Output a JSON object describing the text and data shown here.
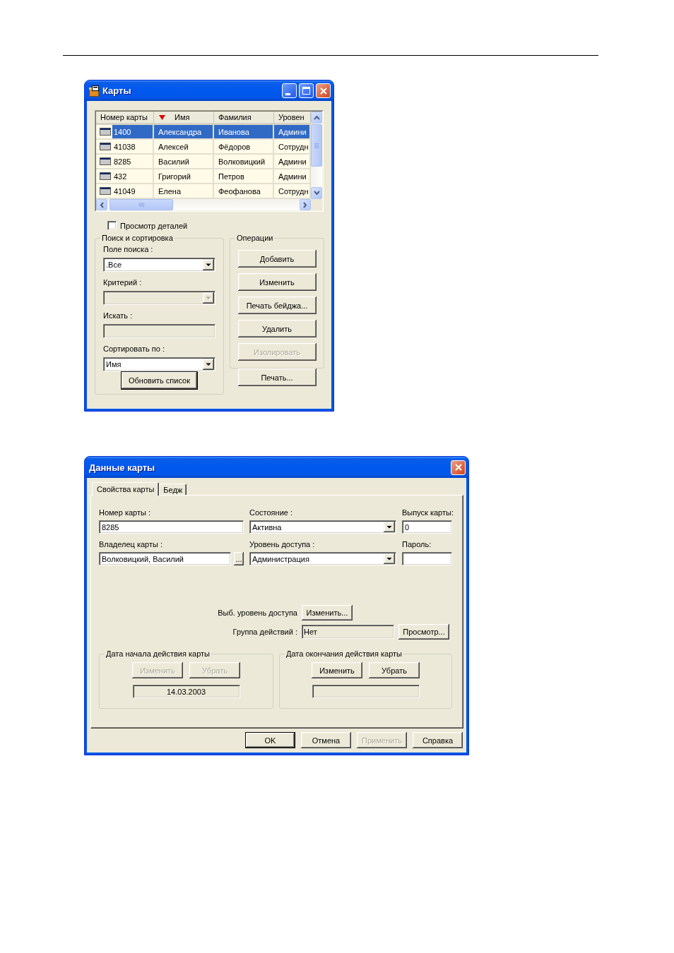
{
  "cards_window": {
    "title": "Карты",
    "table": {
      "columns": [
        {
          "label": "Номер карты",
          "sorted": false
        },
        {
          "label": "Имя",
          "sorted": true
        },
        {
          "label": "Фамилия",
          "sorted": false
        },
        {
          "label": "Уровен",
          "sorted": false
        }
      ],
      "rows": [
        {
          "selected": true,
          "cells": [
            "1400",
            "Александра",
            "Иванова",
            "Админи"
          ]
        },
        {
          "selected": false,
          "cells": [
            "41038",
            "Алексей",
            "Фёдоров",
            "Сотрудн"
          ]
        },
        {
          "selected": false,
          "cells": [
            "8285",
            "Василий",
            "Волковицкий",
            "Админи"
          ]
        },
        {
          "selected": false,
          "cells": [
            "432",
            "Григорий",
            "Петров",
            "Админи"
          ]
        },
        {
          "selected": false,
          "cells": [
            "41049",
            "Елена",
            "Феофанова",
            "Сотрудн"
          ]
        }
      ]
    },
    "details_checkbox": {
      "label": "Просмотр деталей",
      "checked": false
    },
    "search_group": {
      "title": "Поиск и сортировка",
      "fields": [
        {
          "kind": "combo",
          "label": "Поле поиска :",
          "value": ".Все",
          "disabled": false
        },
        {
          "kind": "combo",
          "label": "Критерий :",
          "disabled": true
        },
        {
          "kind": "text",
          "label": "Искать :",
          "disabled": true
        },
        {
          "kind": "combo",
          "label": "Сортировать по :",
          "value": "Имя",
          "disabled": false
        }
      ],
      "button": {
        "label": "Обновить список",
        "default": true
      }
    },
    "operations_group": {
      "title": "Операции",
      "buttons": [
        {
          "label": "Добавить",
          "disabled": false
        },
        {
          "label": "Изменить",
          "disabled": false
        },
        {
          "label": "Печать бейджа...",
          "disabled": false
        },
        {
          "label": "Удалить",
          "disabled": false
        },
        {
          "label": "Изолировать",
          "disabled": true
        }
      ]
    },
    "print_button": {
      "label": "Печать..."
    }
  },
  "card_dialog": {
    "title": "Данные карты",
    "tabs": [
      {
        "label": "Свойства карты",
        "selected": true
      },
      {
        "label": "Бедж",
        "selected": false
      }
    ],
    "fields": [
      {
        "kind": "text",
        "label": "Номер карты :",
        "value": "8285"
      },
      {
        "kind": "combo",
        "label": "Состояние :",
        "value": "Активна"
      },
      {
        "kind": "text",
        "label": "Выпуск карты:",
        "value": "0"
      },
      {
        "kind": "browse",
        "label": "Владелец карты :",
        "value": "Волковицкий, Василий",
        "button": "..."
      },
      {
        "kind": "combo",
        "label": "Уровень доступа :",
        "value": "Администрация"
      },
      {
        "kind": "text",
        "label": "Пароль:"
      }
    ],
    "access_level": {
      "label": "Выб. уровень доступа",
      "button": "Изменить..."
    },
    "action_group": {
      "label": "Группа действий :",
      "value": "Нет",
      "button": "Просмотр..."
    },
    "date_groups": [
      {
        "title": "Дата начала действия карты",
        "buttons": [
          {
            "label": "Изменить",
            "disabled": true
          },
          {
            "label": "Убрать",
            "disabled": true
          }
        ],
        "value": "14.03.2003"
      },
      {
        "title": "Дата окончания действия карты",
        "buttons": [
          {
            "label": "Изменить",
            "disabled": false
          },
          {
            "label": "Убрать",
            "disabled": false
          }
        ]
      }
    ],
    "footer_buttons": [
      {
        "label": "OK",
        "default": true,
        "disabled": false
      },
      {
        "label": "Отмена",
        "default": false,
        "disabled": false
      },
      {
        "label": "Применить",
        "default": false,
        "disabled": true
      },
      {
        "label": "Справка",
        "default": false,
        "disabled": false
      }
    ]
  }
}
